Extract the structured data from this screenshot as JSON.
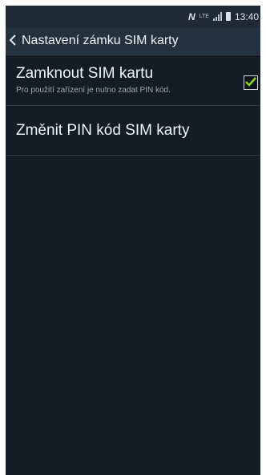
{
  "status_bar": {
    "nfc_label": "N",
    "network_label": "LTE",
    "time": "13:40",
    "icons": [
      "nfc-icon",
      "lte-icon",
      "signal-icon",
      "battery-icon"
    ]
  },
  "action_bar": {
    "back_icon": "chevron-left-icon",
    "back_glyph": "<",
    "title": "Nastavení zámku SIM karty"
  },
  "settings": {
    "items": [
      {
        "title": "Zamknout SIM kartu",
        "summary": "Pro použití zařízení je nutno zadat PIN kód.",
        "checked": true
      },
      {
        "title": "Změnit PIN kód SIM karty"
      }
    ]
  },
  "colors": {
    "background": "#141c26",
    "action_bar": "#24313e",
    "checkmark": "#8fd21f"
  }
}
